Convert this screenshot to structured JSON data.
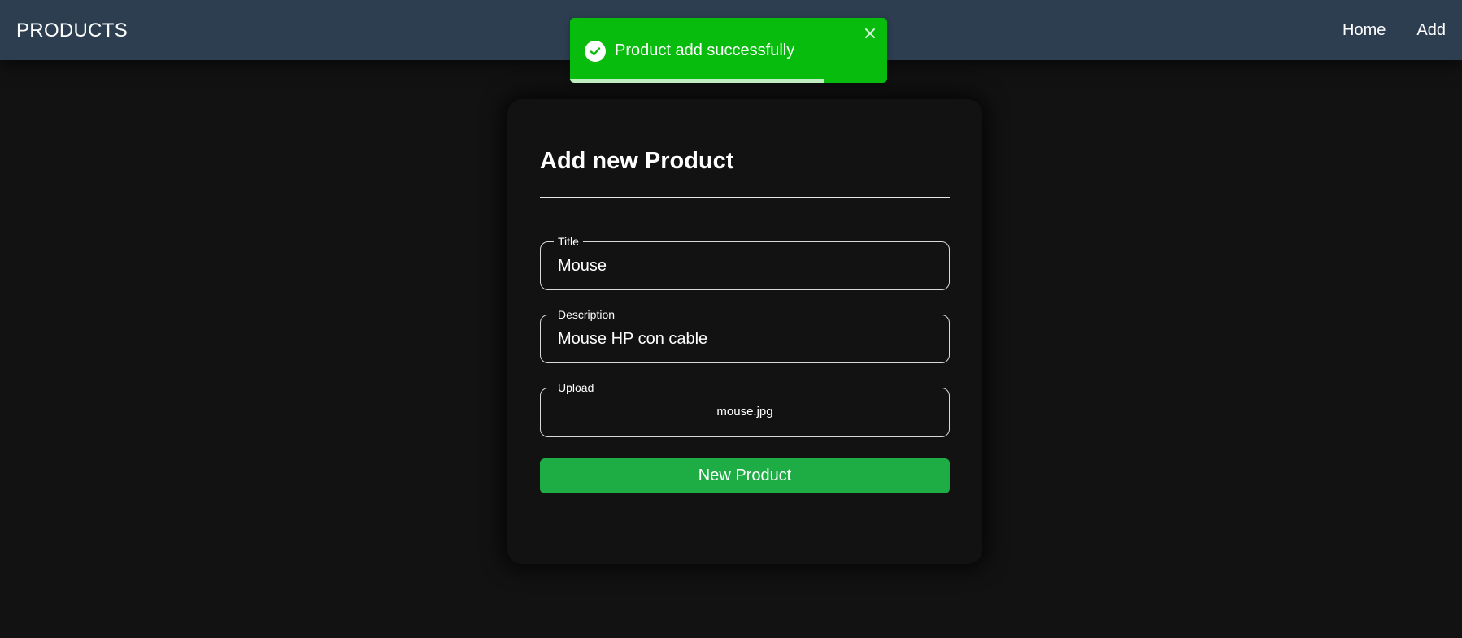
{
  "navbar": {
    "brand": "PRODUCTS",
    "links": [
      "Home",
      "Add"
    ]
  },
  "toast": {
    "message": "Product add successfully",
    "progress": 0.8,
    "color": "#07bc0c",
    "icon": "check-circle-icon"
  },
  "form": {
    "title": "Add new Product",
    "fields": {
      "title": {
        "label": "Title",
        "value": "Mouse"
      },
      "description": {
        "label": "Description",
        "value": "Mouse HP con cable"
      },
      "upload": {
        "label": "Upload",
        "value": "mouse.jpg"
      }
    },
    "submit_label": "New Product",
    "submit_color": "#1eac44"
  },
  "colors": {
    "navbar_bg": "#2c3e50",
    "page_bg": "#121212"
  }
}
